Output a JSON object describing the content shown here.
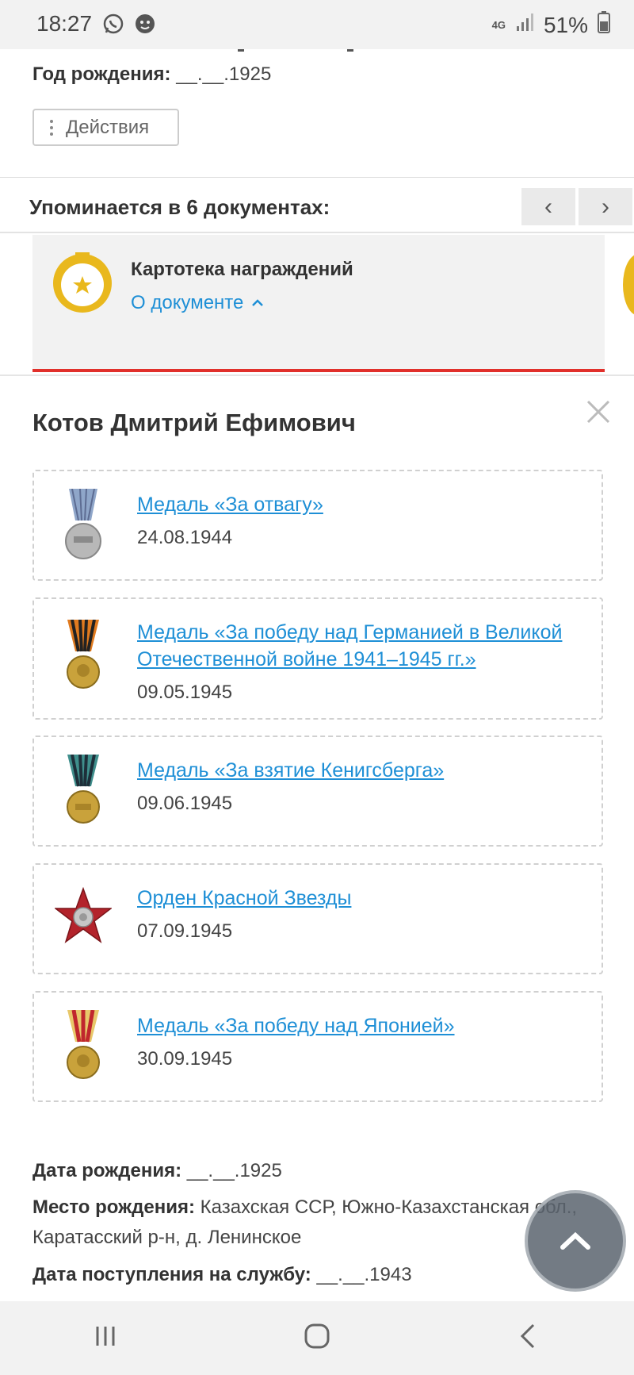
{
  "status_bar": {
    "time": "18:27",
    "network": "4G",
    "battery": "51%",
    "left_icons": [
      "whatsapp-icon",
      "shield-app-icon"
    ],
    "right_icons": [
      "signal-icon",
      "battery-icon"
    ]
  },
  "profile": {
    "birth_year_label": "Год рождения:",
    "birth_year_value": "__.__.1925",
    "actions_label": "Действия"
  },
  "mentions": {
    "title": "Упоминается в 6 документах:",
    "prev_icon": "‹",
    "next_icon": "›"
  },
  "document": {
    "title": "Картотека награждений",
    "link_label": "О документе",
    "accent_color": "#e1302b",
    "icon_color": "#e9b81d"
  },
  "person": {
    "name": "Котов Дмитрий Ефимович"
  },
  "awards": [
    {
      "name": "Медаль «За отвагу»",
      "date": "24.08.1944",
      "icon": "medal-for-courage-icon"
    },
    {
      "name": "Медаль «За победу над Германией в Великой Отечественной войне 1941–1945 гг.»",
      "date": "09.05.1945",
      "icon": "medal-victory-germany-icon"
    },
    {
      "name": "Медаль «За взятие Кенигсберга»",
      "date": "09.06.1945",
      "icon": "medal-koenigsberg-icon"
    },
    {
      "name": "Орден Красной Звезды",
      "date": "07.09.1945",
      "icon": "order-red-star-icon"
    },
    {
      "name": "Медаль «За победу над Японией»",
      "date": "30.09.1945",
      "icon": "medal-victory-japan-icon"
    }
  ],
  "details": {
    "birth_date_label": "Дата рождения:",
    "birth_date_value": "__.__.1925",
    "birth_place_label": "Место рождения:",
    "birth_place_value": "Казахская ССР, Южно-Казахстанская обл., Каратасский р-н, д. Ленинское",
    "service_start_label": "Дата поступления на службу:",
    "service_start_value": "__.__.1943"
  },
  "link_color": "#1e8fd6"
}
